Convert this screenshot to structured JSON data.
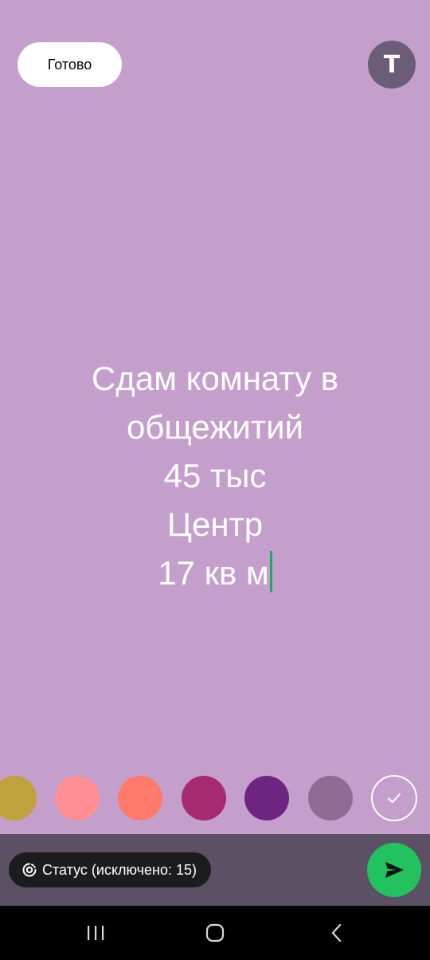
{
  "toolbar": {
    "done_label": "Готово",
    "font_button_label": "T",
    "font_icon": "text-style-icon"
  },
  "status_text": {
    "lines": [
      "Сдам комнату в",
      "общежитий",
      "45 тыс",
      "Центр",
      "17 кв м"
    ]
  },
  "palette": {
    "swatches": [
      {
        "name": "mustard",
        "color": "#bfa23c"
      },
      {
        "name": "pink",
        "color": "#ff8f94"
      },
      {
        "name": "coral",
        "color": "#ff7a6b"
      },
      {
        "name": "magenta",
        "color": "#a62a6f"
      },
      {
        "name": "purple",
        "color": "#6e2481"
      },
      {
        "name": "mauve",
        "color": "#8f6a93"
      }
    ],
    "selected": {
      "name": "lilac",
      "color": "#c49fcc",
      "icon": "check-icon"
    }
  },
  "bottom_bar": {
    "audience_label": "Статус (исключено: 15)",
    "audience_icon": "status-privacy-icon",
    "send_icon": "send-icon"
  },
  "nav": {
    "recents_icon": "recents-icon",
    "home_icon": "home-icon",
    "back_icon": "back-icon"
  },
  "colors": {
    "background": "#c49fcc",
    "bottom_bar": "#5b5064",
    "send": "#22c25e",
    "cursor": "#1faa5b"
  }
}
